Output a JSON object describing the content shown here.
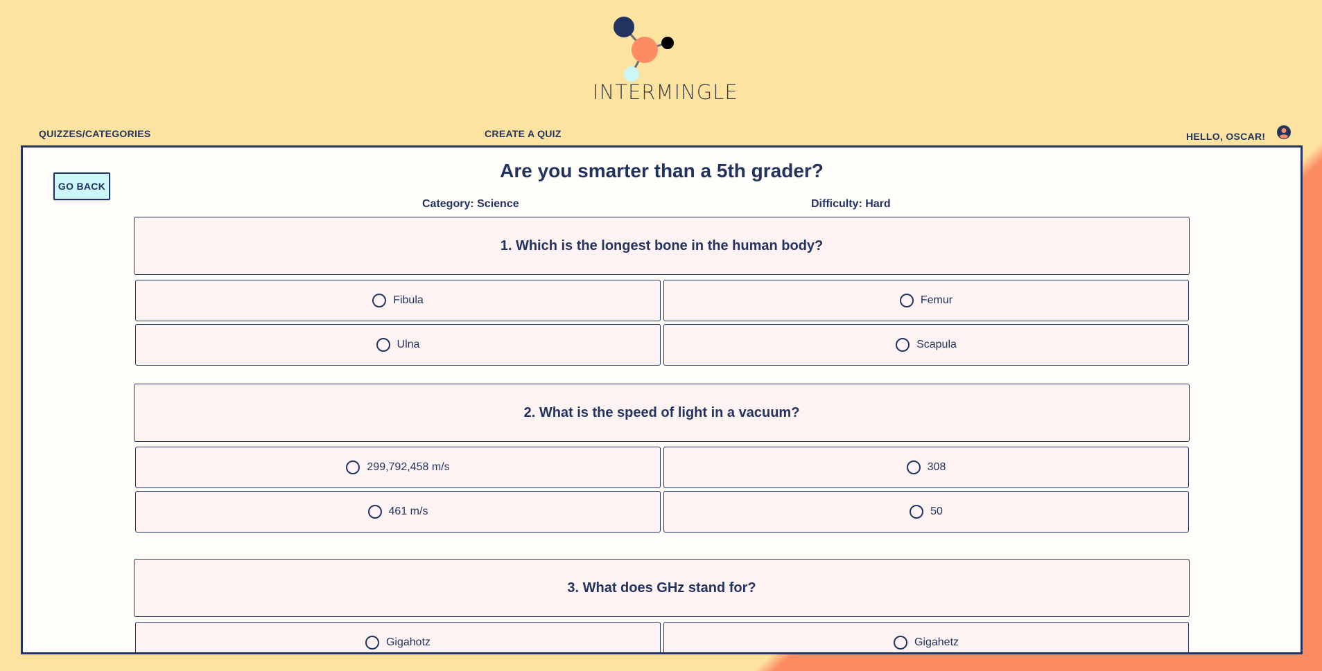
{
  "brand": {
    "name": "INTERMINGLE"
  },
  "nav": {
    "quizzes": "QUIZZES/CATEGORIES",
    "create": "CREATE A QUIZ",
    "greeting": "HELLO, OSCAR!",
    "user_icon": "user-circle-icon"
  },
  "colors": {
    "background": "#fde3a0",
    "accent": "#fd8b64",
    "primary": "#23335f",
    "button_bg": "#cbf7f9",
    "card_bg": "#fdf3f3"
  },
  "quiz": {
    "back_label": "GO BACK",
    "title": "Are you smarter than a 5th grader?",
    "category": "Category: Science",
    "difficulty": "Difficulty: Hard",
    "questions": [
      {
        "text": "1. Which is the longest bone in the human body?",
        "answers": [
          "Fibula",
          "Femur",
          "Ulna",
          "Scapula"
        ]
      },
      {
        "text": "2. What is the speed of light in a vacuum?",
        "answers": [
          "299,792,458 m/s",
          "308",
          "461 m/s",
          "50"
        ]
      },
      {
        "text": "3. What does GHz stand for?",
        "answers": [
          "Gigahotz",
          "Gigahetz"
        ]
      }
    ]
  }
}
